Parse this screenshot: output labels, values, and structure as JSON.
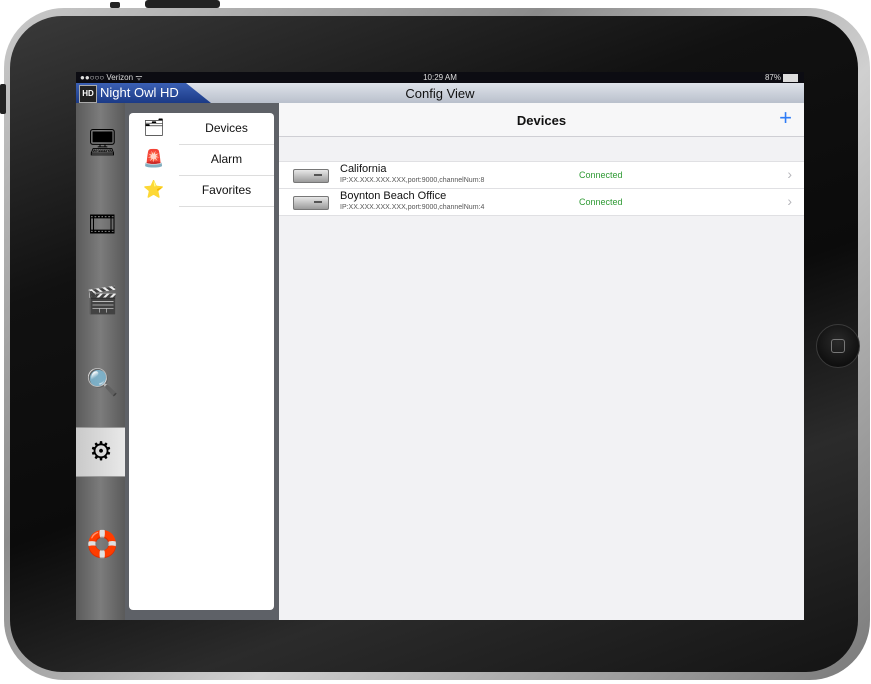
{
  "status_bar": {
    "carrier": "●●○○○ Verizon ᯤ",
    "time": "10:29 AM",
    "battery": "87%"
  },
  "app": {
    "brand_logo": "HD",
    "brand": "Night Owl HD",
    "window_title": "Config View"
  },
  "rail": {
    "items": [
      {
        "icon": "monitor-camera-icon",
        "glyph": "🖥"
      },
      {
        "icon": "film-reel-icon",
        "glyph": "🎞"
      },
      {
        "icon": "clapperboard-icon",
        "glyph": "🎬"
      },
      {
        "icon": "search-monitor-icon",
        "glyph": "🔍"
      },
      {
        "icon": "gear-icon",
        "glyph": "⚙",
        "active": true
      },
      {
        "icon": "lifebuoy-icon",
        "glyph": "🛟"
      }
    ]
  },
  "menu": {
    "items": [
      {
        "label": "Devices",
        "icon": "dvr-folder-icon",
        "glyph": "🗂"
      },
      {
        "label": "Alarm",
        "icon": "siren-icon",
        "glyph": "🚨"
      },
      {
        "label": "Favorites",
        "icon": "star-icon",
        "glyph": "⭐"
      }
    ]
  },
  "devices_view": {
    "title": "Devices",
    "add_label": "+",
    "devices": [
      {
        "name": "California",
        "info": "IP:XX.XXX.XXX.XXX,port:9000,channelNum:8",
        "status": "Connected"
      },
      {
        "name": "Boynton Beach Office",
        "info": "IP:XX.XXX.XXX.XXX,port:9000,channelNum:4",
        "status": "Connected"
      }
    ]
  },
  "colors": {
    "accent": "#2e7cf6",
    "connected": "#2f9a34",
    "brand_tab": "#2a4c9e"
  }
}
